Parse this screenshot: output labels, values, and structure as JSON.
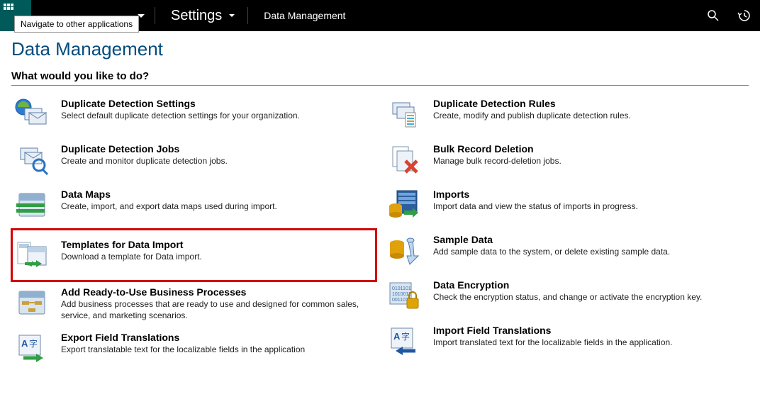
{
  "topbar": {
    "tooltip": "Navigate to other applications",
    "settings_label": "Settings",
    "breadcrumb": "Data Management"
  },
  "page": {
    "title": "Data Management",
    "prompt": "What would you like to do?"
  },
  "items": {
    "left": [
      {
        "title": "Duplicate Detection Settings",
        "desc": "Select default duplicate detection settings for your organization."
      },
      {
        "title": "Duplicate Detection Jobs",
        "desc": "Create and monitor duplicate detection jobs."
      },
      {
        "title": "Data Maps",
        "desc": "Create, import, and export data maps used during import."
      },
      {
        "title": "Templates for Data Import",
        "desc": "Download a template for Data import.",
        "highlighted": true
      },
      {
        "title": "Add Ready-to-Use Business Processes",
        "desc": "Add business processes that are ready to use and designed for common sales, service, and marketing scenarios."
      },
      {
        "title": "Export Field Translations",
        "desc": "Export translatable text for the localizable fields in the application"
      }
    ],
    "right": [
      {
        "title": "Duplicate Detection Rules",
        "desc": "Create, modify and publish duplicate detection rules."
      },
      {
        "title": "Bulk Record Deletion",
        "desc": "Manage bulk record-deletion jobs."
      },
      {
        "title": "Imports",
        "desc": "Import data and view the status of imports in progress."
      },
      {
        "title": "Sample Data",
        "desc": "Add sample data to the system, or delete existing sample data."
      },
      {
        "title": "Data Encryption",
        "desc": "Check the encryption status, and change or activate the encryption key."
      },
      {
        "title": "Import Field Translations",
        "desc": "Import translated text for the localizable fields in the application."
      }
    ]
  }
}
